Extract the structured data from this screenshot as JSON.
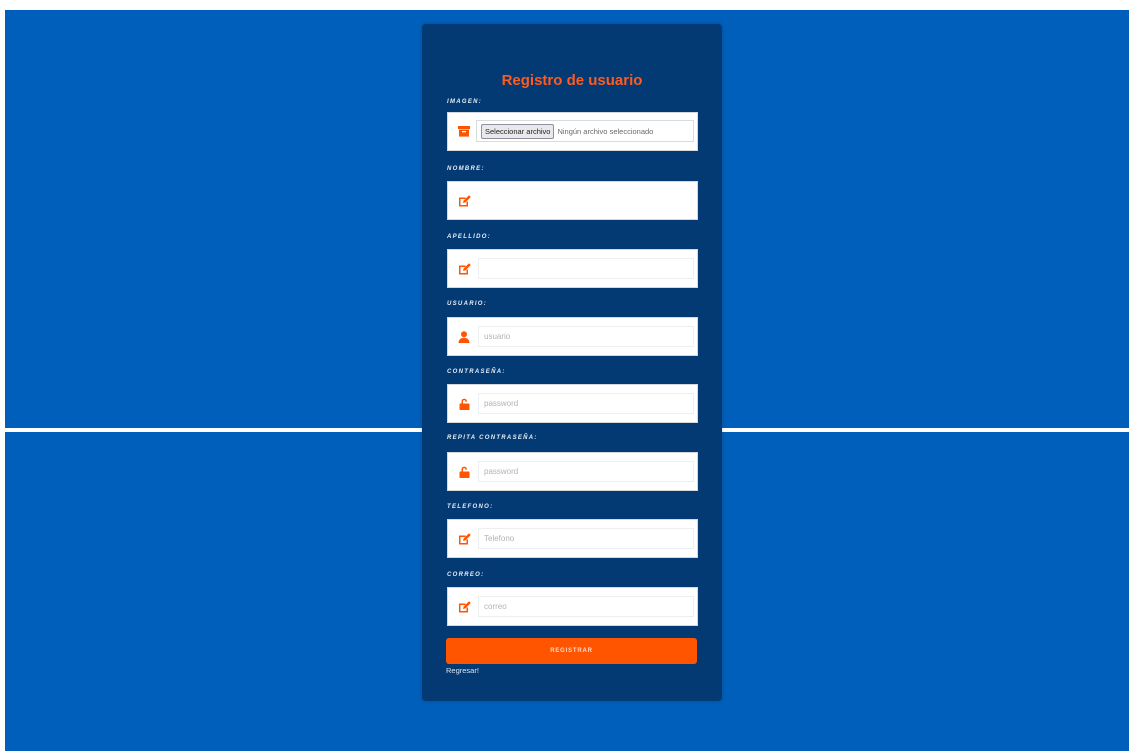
{
  "colors": {
    "page_background": "#005fbb",
    "card_background": "#033a73",
    "accent": "#ff5500",
    "title": "#ff5a1f"
  },
  "form": {
    "title": "Registro de usuario",
    "fields": [
      {
        "label": "IMAGEN:",
        "type": "file",
        "icon": "archive-icon",
        "button_label": "Seleccionar archivo",
        "status_text": "Ningún archivo seleccionado"
      },
      {
        "label": "NOMBRE:",
        "type": "text",
        "icon": "edit-icon",
        "value": "",
        "placeholder": ""
      },
      {
        "label": "APELLIDO:",
        "type": "text",
        "icon": "edit-icon",
        "value": "",
        "placeholder": ""
      },
      {
        "label": "USUARIO:",
        "type": "text",
        "icon": "user-icon",
        "value": "",
        "placeholder": "usuario"
      },
      {
        "label": "CONTRASEÑA:",
        "type": "password",
        "icon": "unlock-icon",
        "value": "",
        "placeholder": "password"
      },
      {
        "label": "REPITA CONTRASEÑA:",
        "type": "password",
        "icon": "unlock-icon",
        "value": "",
        "placeholder": "password"
      },
      {
        "label": "TELEFONO:",
        "type": "text",
        "icon": "edit-icon",
        "value": "",
        "placeholder": "Telefono"
      },
      {
        "label": "CORREO:",
        "type": "text",
        "icon": "edit-icon",
        "value": "",
        "placeholder": "correo"
      }
    ],
    "submit_label": "REGISTRAR",
    "back_link_label": "Regresar!"
  }
}
